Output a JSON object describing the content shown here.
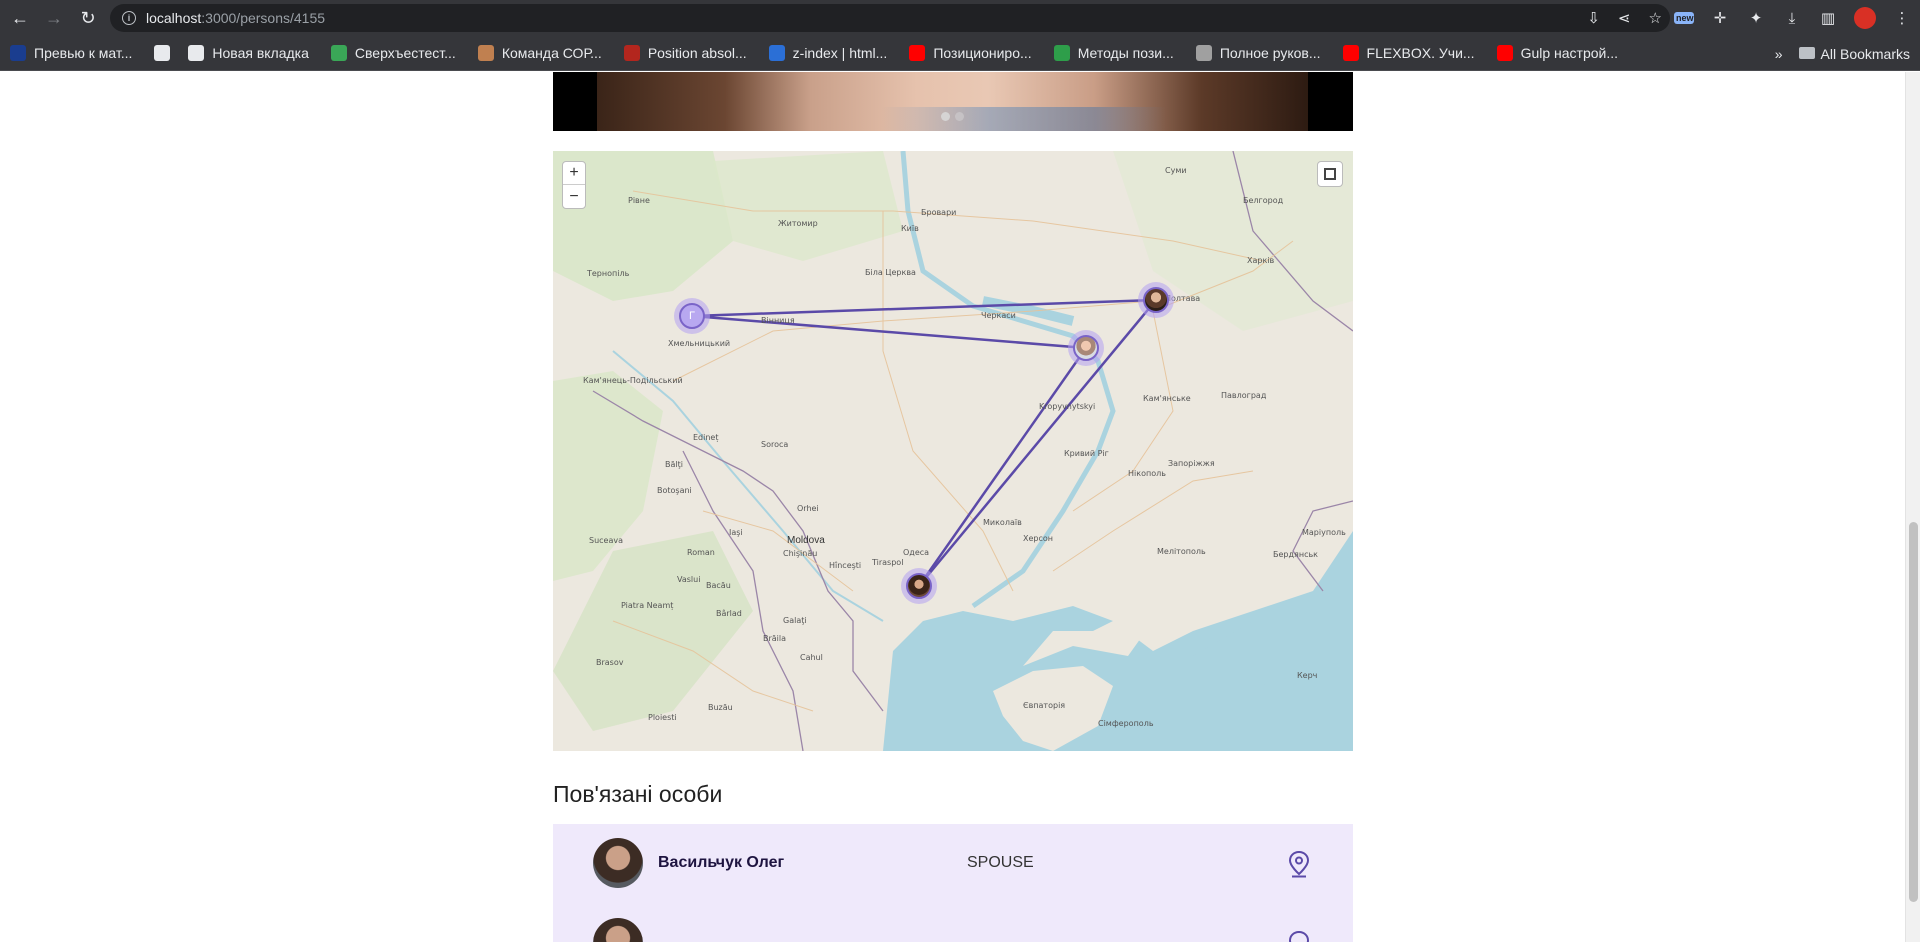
{
  "browser": {
    "url_host": "localhost",
    "url_path": ":3000/persons/4155",
    "new_badge": "new",
    "bookmarks": [
      {
        "label": "Превью к мат...",
        "color": "#1a3d8f"
      },
      {
        "label": "",
        "color": "#e8eaed"
      },
      {
        "label": "Новая вкладка",
        "color": "#e8eaed"
      },
      {
        "label": "Сверхъестест...",
        "color": "#3aa757"
      },
      {
        "label": "Команда СОР...",
        "color": "#c08050"
      },
      {
        "label": "Position absol...",
        "color": "#b3261e"
      },
      {
        "label": "z-index | html...",
        "color": "#2b6fd6"
      },
      {
        "label": "Позициониро...",
        "color": "#ff0000"
      },
      {
        "label": "Методы пози...",
        "color": "#2e9e4a"
      },
      {
        "label": "Полное руков...",
        "color": "#a0a0a0"
      },
      {
        "label": "FLEXBOX. Учи...",
        "color": "#ff0000"
      },
      {
        "label": "Gulp настрой...",
        "color": "#ff0000"
      }
    ],
    "more_label": "»",
    "all_bookmarks": "All Bookmarks"
  },
  "map": {
    "zoom_in": "+",
    "zoom_out": "−",
    "cluster_label": "Г",
    "line_color": "#5b4aa8",
    "countries": [
      {
        "label": "Moldova"
      }
    ],
    "cities": [
      {
        "label": "Рівне"
      },
      {
        "label": "Житомир"
      },
      {
        "label": "Київ"
      },
      {
        "label": "Бровари"
      },
      {
        "label": "Суми"
      },
      {
        "label": "Белгород"
      },
      {
        "label": "Харків"
      },
      {
        "label": "Тернопіль"
      },
      {
        "label": "Біла Церква"
      },
      {
        "label": "Черкаси"
      },
      {
        "label": "Вінниця"
      },
      {
        "label": "Полтава"
      },
      {
        "label": "Кам'янське"
      },
      {
        "label": "Павлоград"
      },
      {
        "label": "Кривий Ріг"
      },
      {
        "label": "Запоріжжя"
      },
      {
        "label": "Миколаїв"
      },
      {
        "label": "Херсон"
      },
      {
        "label": "Мелітополь"
      },
      {
        "label": "Маріуполь"
      },
      {
        "label": "Бердянськ"
      },
      {
        "label": "Нікополь"
      },
      {
        "label": "Одеса"
      },
      {
        "label": "Chişinău"
      },
      {
        "label": "Bălţi"
      },
      {
        "label": "Iaşi"
      },
      {
        "label": "Suceava"
      },
      {
        "label": "Botoşani"
      },
      {
        "label": "Roman"
      },
      {
        "label": "Bacău"
      },
      {
        "label": "Bârlad"
      },
      {
        "label": "Galaţi"
      },
      {
        "label": "Brăila"
      },
      {
        "label": "Brasov"
      },
      {
        "label": "Ploiesti"
      },
      {
        "label": "Buzău"
      },
      {
        "label": "Hînceşti"
      },
      {
        "label": "Tiraspol"
      },
      {
        "label": "Cahul"
      },
      {
        "label": "Сімферополь"
      },
      {
        "label": "Євпаторія"
      },
      {
        "label": "Керч"
      },
      {
        "label": "Кам'янець-Подільський"
      },
      {
        "label": "Хмельницький"
      },
      {
        "label": "Soroca"
      },
      {
        "label": "Orhei"
      },
      {
        "label": "Edineț"
      },
      {
        "label": "Piatra Neamț"
      },
      {
        "label": "Vaslui"
      },
      {
        "label": "Kropyvnytskyi"
      }
    ]
  },
  "related": {
    "title": "Пов'язані особи",
    "items": [
      {
        "name": "Васильчук Олег",
        "relation": "SPOUSE"
      }
    ]
  }
}
